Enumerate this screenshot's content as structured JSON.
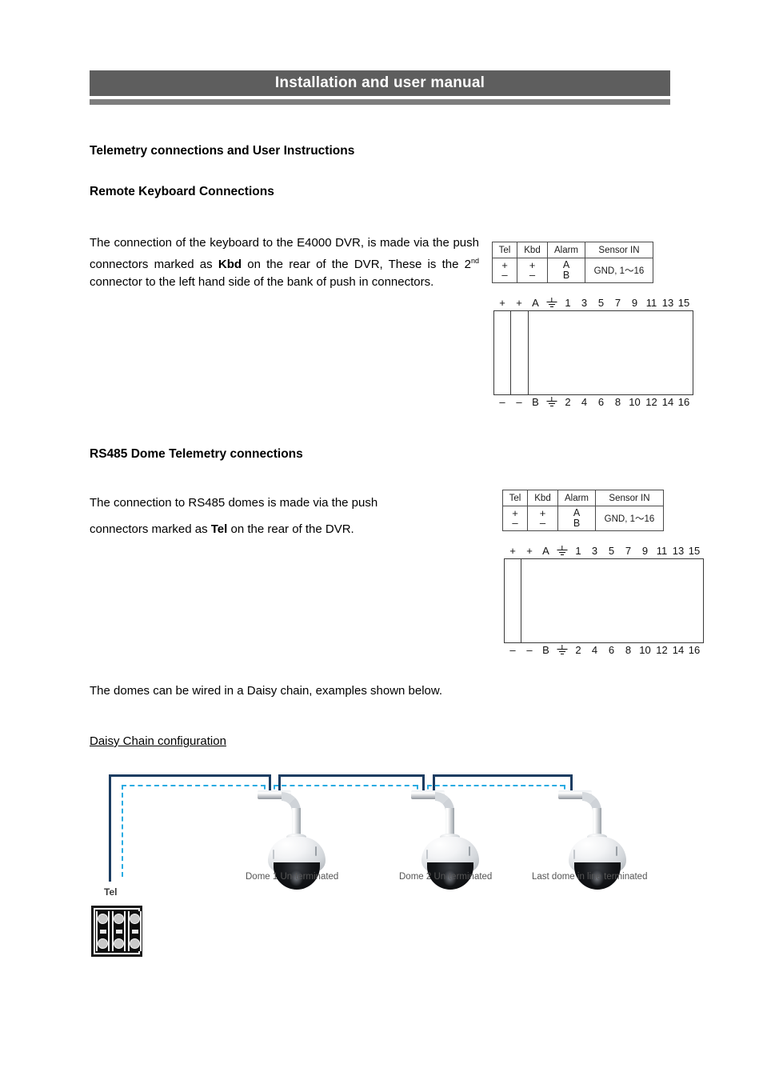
{
  "header": {
    "title": "Installation and user manual"
  },
  "sections": {
    "main_heading": "Telemetry connections and User Instructions",
    "kbd_heading": "Remote Keyboard Connections",
    "kbd_para_1": "The connection of the keyboard to the E4000 DVR, is made via the push connectors marked as ",
    "kbd_para_bold": "Kbd",
    "kbd_para_2": " on the rear of the DVR, These is the 2",
    "kbd_para_sup": "nd",
    "kbd_para_3": " connector to the left hand side of the bank of push in connectors.",
    "rs485_heading": "RS485 Dome Telemetry connections",
    "rs485_para_1": "The connection to RS485 domes is made via the push",
    "rs485_para_2a": "connectors marked as ",
    "rs485_para_bold": "Tel",
    "rs485_para_2b": " on the rear of the DVR.",
    "daisy_intro": "The domes can be wired in a Daisy chain, examples shown below.",
    "daisy_subheading": "Daisy Chain configuration"
  },
  "legend_table": {
    "headers": [
      "Tel",
      "Kbd",
      "Alarm",
      "Sensor IN"
    ],
    "values": {
      "tel_plus": "+",
      "tel_minus": "–",
      "kbd_plus": "+",
      "kbd_minus": "–",
      "alarm_a": "A",
      "alarm_b": "B",
      "sensor": "GND, 1～16"
    }
  },
  "connector_block": {
    "top_labels": [
      "+",
      "+",
      "A",
      "gnd",
      "1",
      "3",
      "5",
      "7",
      "9",
      "11",
      "13",
      "15"
    ],
    "bottom_labels": [
      "–",
      "–",
      "B",
      "gnd",
      "2",
      "4",
      "6",
      "8",
      "10",
      "12",
      "14",
      "16"
    ]
  },
  "daisy_chain": {
    "tel_label": "Tel",
    "domes": [
      {
        "caption": "Dome 1 Un-terminated"
      },
      {
        "caption": "Dome 2 Un-terminated"
      },
      {
        "caption": "Last dome in line terminated"
      }
    ],
    "colors": {
      "solid_line": "#1b3c61",
      "dashed_line": "#29abe2"
    }
  },
  "theme": {
    "header_bar": "#5e5e5e",
    "header_rule": "#7d7d7d",
    "text": "#000000"
  }
}
